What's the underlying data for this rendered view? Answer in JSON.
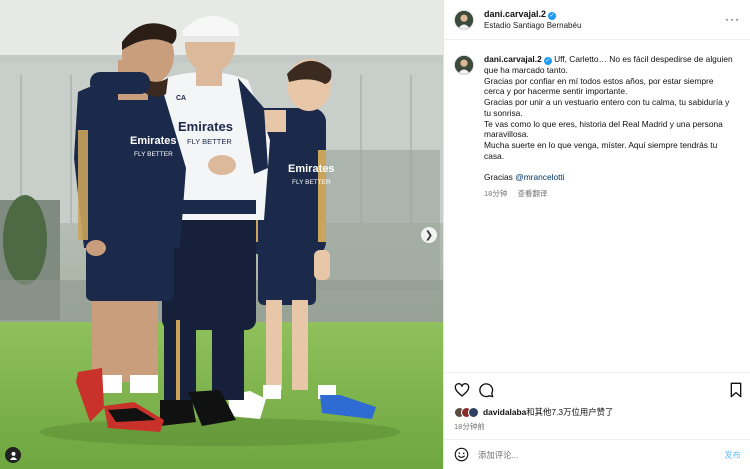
{
  "post": {
    "username": "dani.carvajal.2",
    "location": "Estadio Santiago Bernabéu",
    "caption_lines": [
      "Uff, Carletto… No es fácil despedirse de alguien que ha marcado tanto.",
      "Gracias por confiar en mí todos estos años, por estar siempre cerca y por hacerme sentir importante.",
      "Gracias por unir a un vestuario entero con tu calma, tu sabiduría y tu sonrisa.",
      "Te vas como lo que eres, historia del Real Madrid y una persona maravillosa.",
      "Mucha suerte en lo que venga, míster. Aquí siempre tendrás tu casa."
    ],
    "thanks_prefix": "Gracias",
    "mention": "@mrancelotti",
    "caption_time": "18分钟",
    "translate_label": "查看翻译",
    "likes_user": "davidalaba",
    "likes_rest": "和其他7.3万位用户赞了",
    "post_time": "18分钟前",
    "comment_placeholder": "添加评论...",
    "post_button": "发布",
    "more_label": "···"
  },
  "photo": {
    "shirt_sponsor": "Emirates",
    "shirt_sub": "FLY BETTER",
    "coach_initials": "CA"
  },
  "icons": {
    "verified": "verified-badge-icon",
    "like": "heart-icon",
    "comment": "comment-icon",
    "save": "bookmark-icon",
    "emoji": "emoji-icon",
    "carousel": "chevron-right-icon",
    "tag": "person-tag-icon"
  },
  "colors": {
    "kit_navy": "#1b2a4a",
    "kit_gold": "#c9a45a",
    "grass": "#7fb24e",
    "link": "#00376b",
    "verified": "#1d9bf0",
    "post_button": "#0095f6"
  }
}
